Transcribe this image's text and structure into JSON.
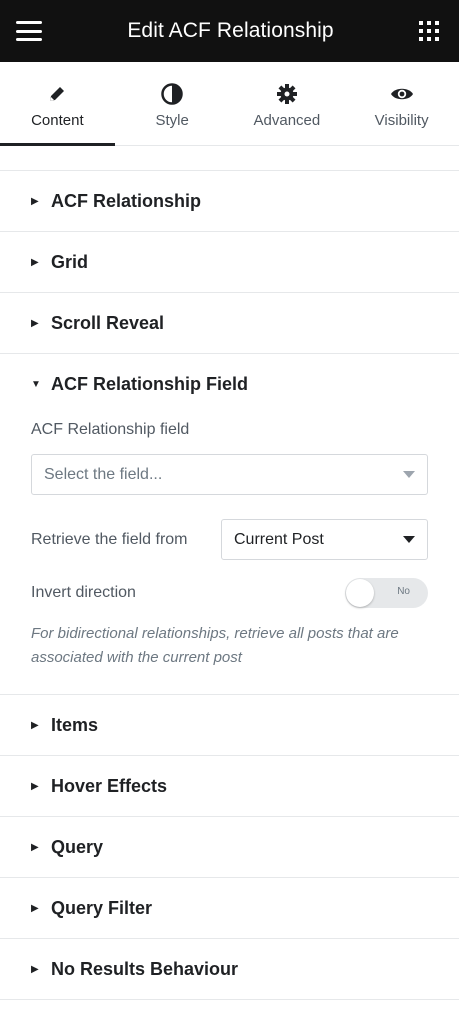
{
  "header": {
    "title": "Edit ACF Relationship",
    "menu_icon": "hamburger-icon",
    "apps_icon": "grid-icon"
  },
  "tabs": [
    {
      "label": "Content",
      "icon": "pencil-icon",
      "active": true
    },
    {
      "label": "Style",
      "icon": "half-circle-icon",
      "active": false
    },
    {
      "label": "Advanced",
      "icon": "gear-icon",
      "active": false
    },
    {
      "label": "Visibility",
      "icon": "eye-icon",
      "active": false
    }
  ],
  "sections_before": [
    {
      "label": "ACF Relationship"
    },
    {
      "label": "Grid"
    },
    {
      "label": "Scroll Reveal"
    }
  ],
  "open_section": {
    "label": "ACF Relationship Field",
    "field_label": "ACF Relationship field",
    "field_placeholder": "Select the field...",
    "retrieve_label": "Retrieve the field from",
    "retrieve_value": "Current Post",
    "invert_label": "Invert direction",
    "invert_toggle_text": "No",
    "help_text": "For bidirectional relationships, retrieve all posts that are associated with the current post"
  },
  "sections_after": [
    {
      "label": "Items"
    },
    {
      "label": "Hover Effects"
    },
    {
      "label": "Query"
    },
    {
      "label": "Query Filter"
    },
    {
      "label": "No Results Behaviour"
    }
  ]
}
